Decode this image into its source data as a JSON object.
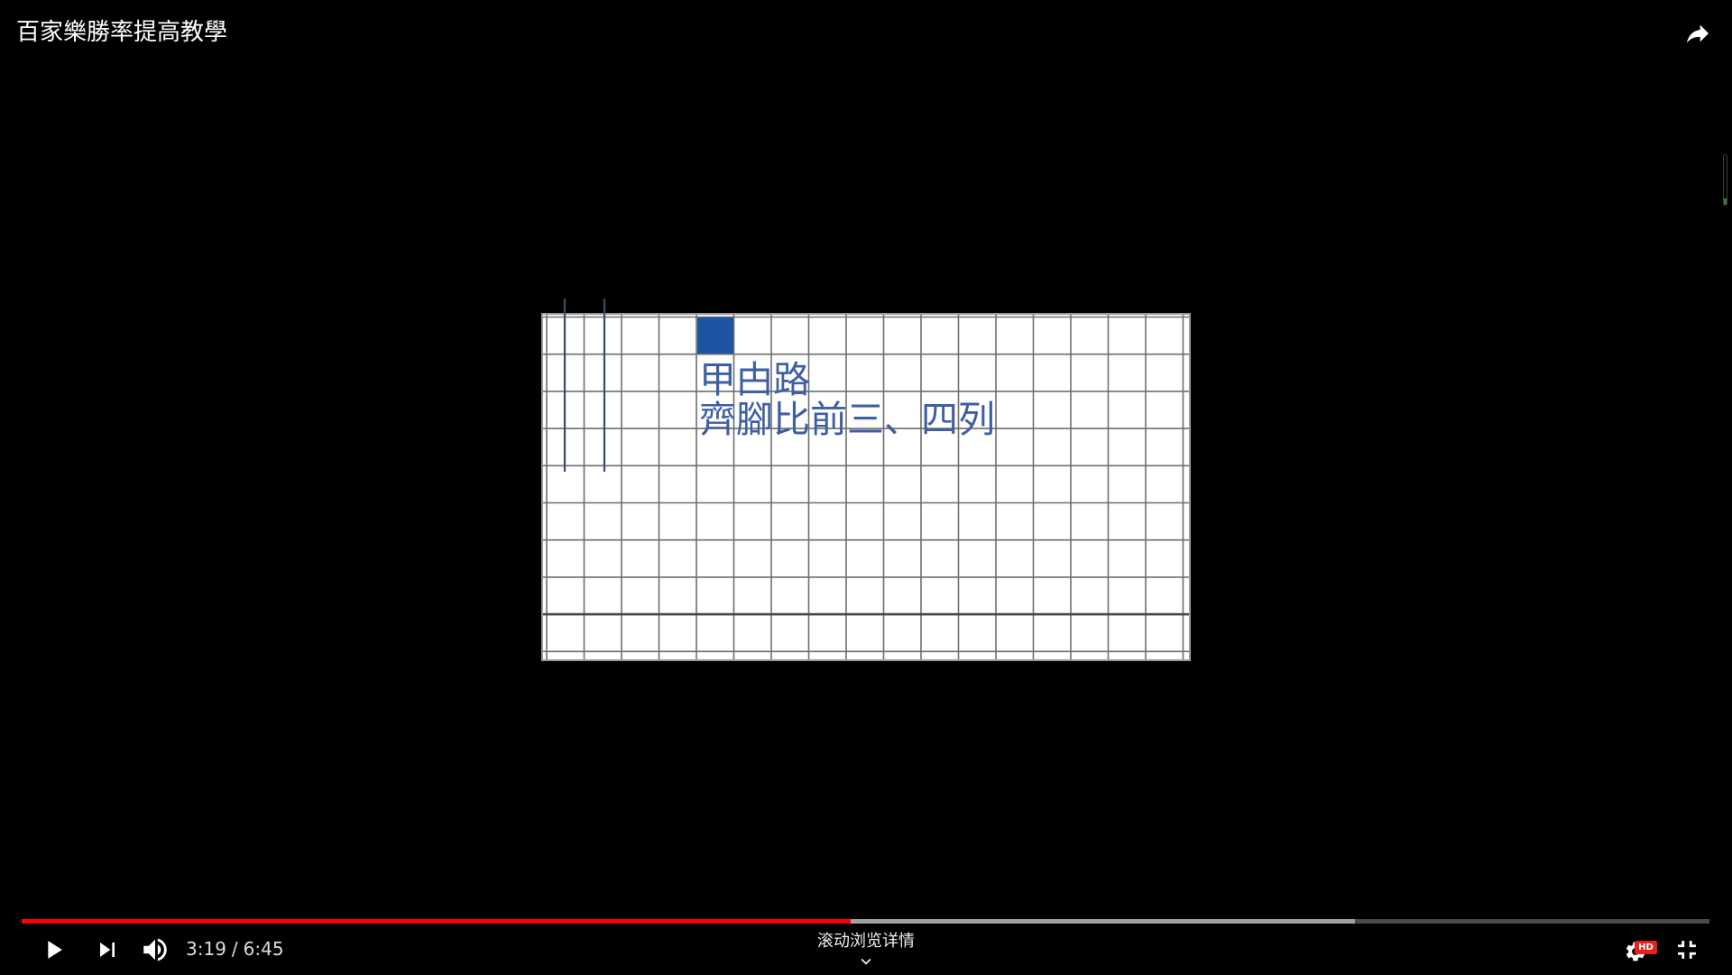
{
  "video": {
    "title": "百家樂勝率提高教學",
    "frame_text": {
      "line1": "甲甴路",
      "line2": "齊腳比前三、四列"
    }
  },
  "player": {
    "time": {
      "current": "3:19",
      "separator": "/",
      "duration": "6:45"
    },
    "progress": {
      "played_fraction": 0.491,
      "buffered_fraction": 0.79
    },
    "scroll_hint": "滚动浏览详情",
    "quality_badge": "HD"
  },
  "icons": {
    "share": "share-icon",
    "play": "play-icon",
    "next": "next-icon",
    "volume": "volume-icon",
    "scroll_hint": "chevron-down-icon",
    "settings": "settings-gear-icon",
    "exit_fullscreen": "exit-fullscreen-icon"
  },
  "colors": {
    "progress_played": "#ff0000",
    "progress_buffered": "#a0a0a0",
    "progress_track": "#4a4a4a",
    "hd_badge": "#e62117",
    "frame_text": "#3f5fa3",
    "frame_square": "#1d55a2",
    "frame_marker_lines": "#3b4b6e",
    "grid_lines": "#6e6e6e"
  }
}
